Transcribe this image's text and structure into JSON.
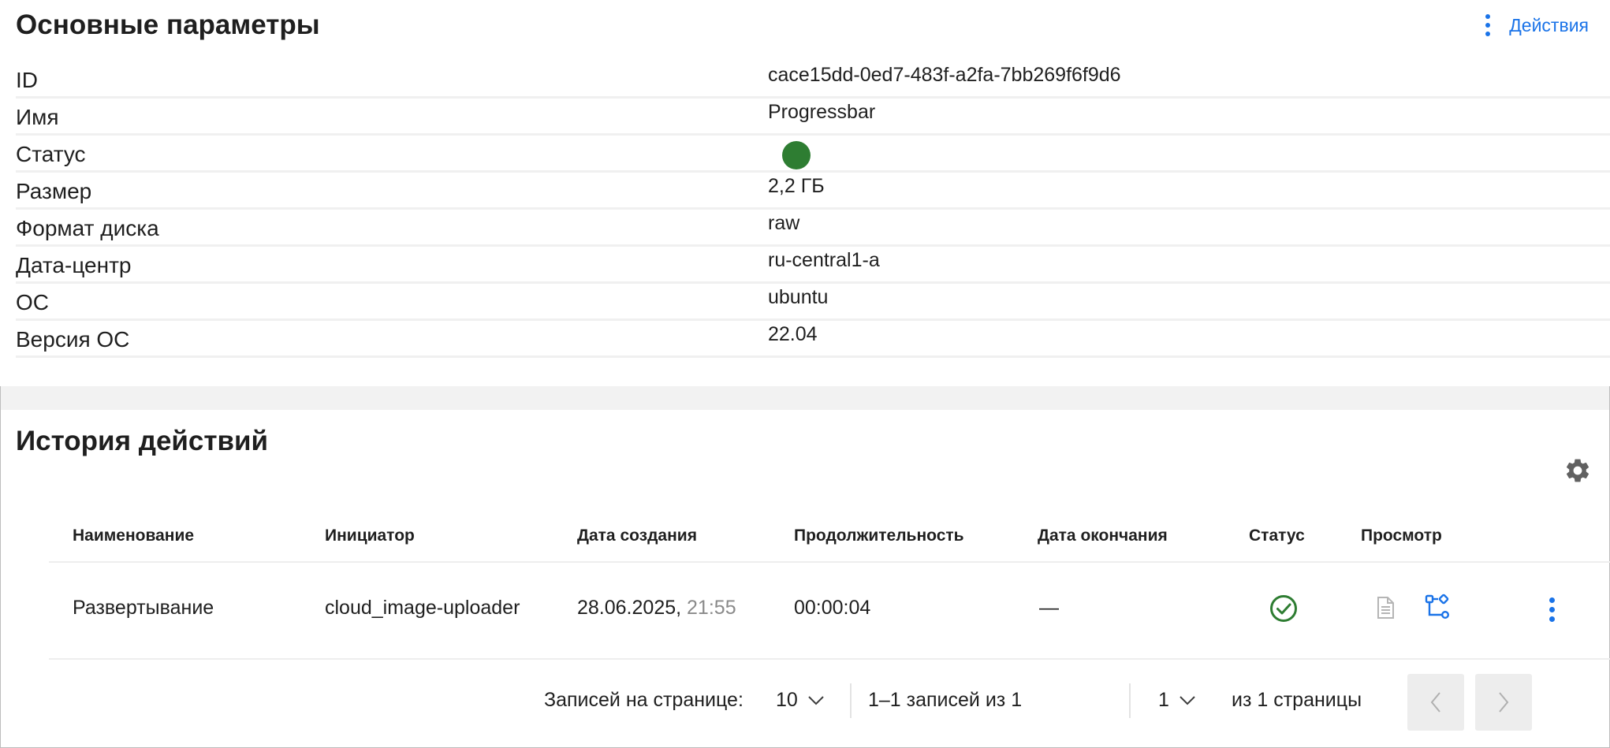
{
  "params": {
    "title": "Основные параметры",
    "actions_label": "Действия",
    "rows": [
      {
        "label": "ID",
        "value": "cace15dd-0ed7-483f-a2fa-7bb269f6f9d6"
      },
      {
        "label": "Имя",
        "value": "Progressbar"
      },
      {
        "label": "Статус",
        "value": ""
      },
      {
        "label": "Размер",
        "value": "2,2 ГБ"
      },
      {
        "label": "Формат диска",
        "value": "raw"
      },
      {
        "label": "Дата-центр",
        "value": "ru-central1-a"
      },
      {
        "label": "ОС",
        "value": "ubuntu"
      },
      {
        "label": "Версия ОС",
        "value": "22.04"
      }
    ],
    "status_color": "#2e7d32"
  },
  "history": {
    "title": "История действий",
    "columns": [
      "Наименование",
      "Инициатор",
      "Дата создания",
      "Продолжительность",
      "Дата окончания",
      "Статус",
      "Просмотр"
    ],
    "rows": [
      {
        "name": "Развертывание",
        "initiator": "cloud_image-uploader",
        "created_date": "28.06.2025,",
        "created_time": "21:55",
        "duration": "00:00:04",
        "finished": "—",
        "status_icon": "check-circle-icon"
      }
    ]
  },
  "pagination": {
    "per_page_label": "Записей на странице:",
    "per_page_value": "10",
    "range_label": "1–1 записей из 1",
    "page_value": "1",
    "pages_label": "из 1 страницы"
  },
  "colors": {
    "accent": "#1a73e8",
    "success": "#2e7d32"
  }
}
